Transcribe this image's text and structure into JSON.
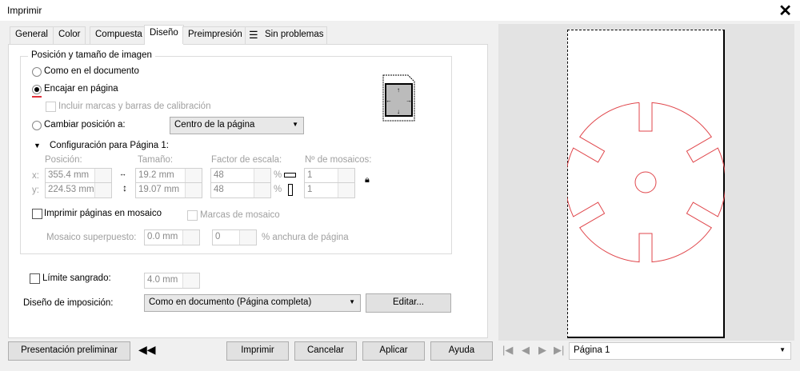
{
  "window": {
    "title": "Imprimir"
  },
  "tabs": [
    "General",
    "Color",
    "Compuesta",
    "Diseño",
    "Preimpresión",
    "Sin problemas"
  ],
  "position_group": {
    "title": "Posición y tamaño de imagen",
    "as_document": "Como en el documento",
    "fit_page": "Encajar en página",
    "include_marks": "Incluir marcas y barras de calibración",
    "reposition": "Cambiar posición a:",
    "reposition_value": "Centro de la página",
    "config_label": "Configuración para Página 1:",
    "position_label": "Posición:",
    "size_label": "Tamaño:",
    "scale_label": "Factor de escala:",
    "tiles_label": "Nº de mosaicos:",
    "x_label": "x:",
    "y_label": "y:",
    "x": "355.4 mm",
    "y": "224.53 mm",
    "width": "19.2 mm",
    "height": "19.07 mm",
    "scale_x": "48",
    "scale_y": "48",
    "pct": "%",
    "tiles_x": "1",
    "tiles_y": "1",
    "tile_pages": "Imprimir páginas en mosaico",
    "tile_marks": "Marcas de mosaico",
    "tile_overlap_label": "Mosaico superpuesto:",
    "tile_overlap": "0.0 mm",
    "tile_overlap_pct": "0",
    "tile_overlap_unit": "% anchura de página",
    "selected": "fit_page"
  },
  "bleed": {
    "label": "Límite sangrado:",
    "value": "4.0 mm"
  },
  "imposition": {
    "label": "Diseño de imposición:",
    "value": "Como en documento (Página completa)",
    "edit": "Editar..."
  },
  "footer": {
    "preview": "Presentación preliminar",
    "print": "Imprimir",
    "cancel": "Cancelar",
    "apply": "Aplicar",
    "help": "Ayuda"
  },
  "preview_nav": {
    "page_select": "Página 1"
  },
  "colors": {
    "outline": "#e0464b"
  }
}
